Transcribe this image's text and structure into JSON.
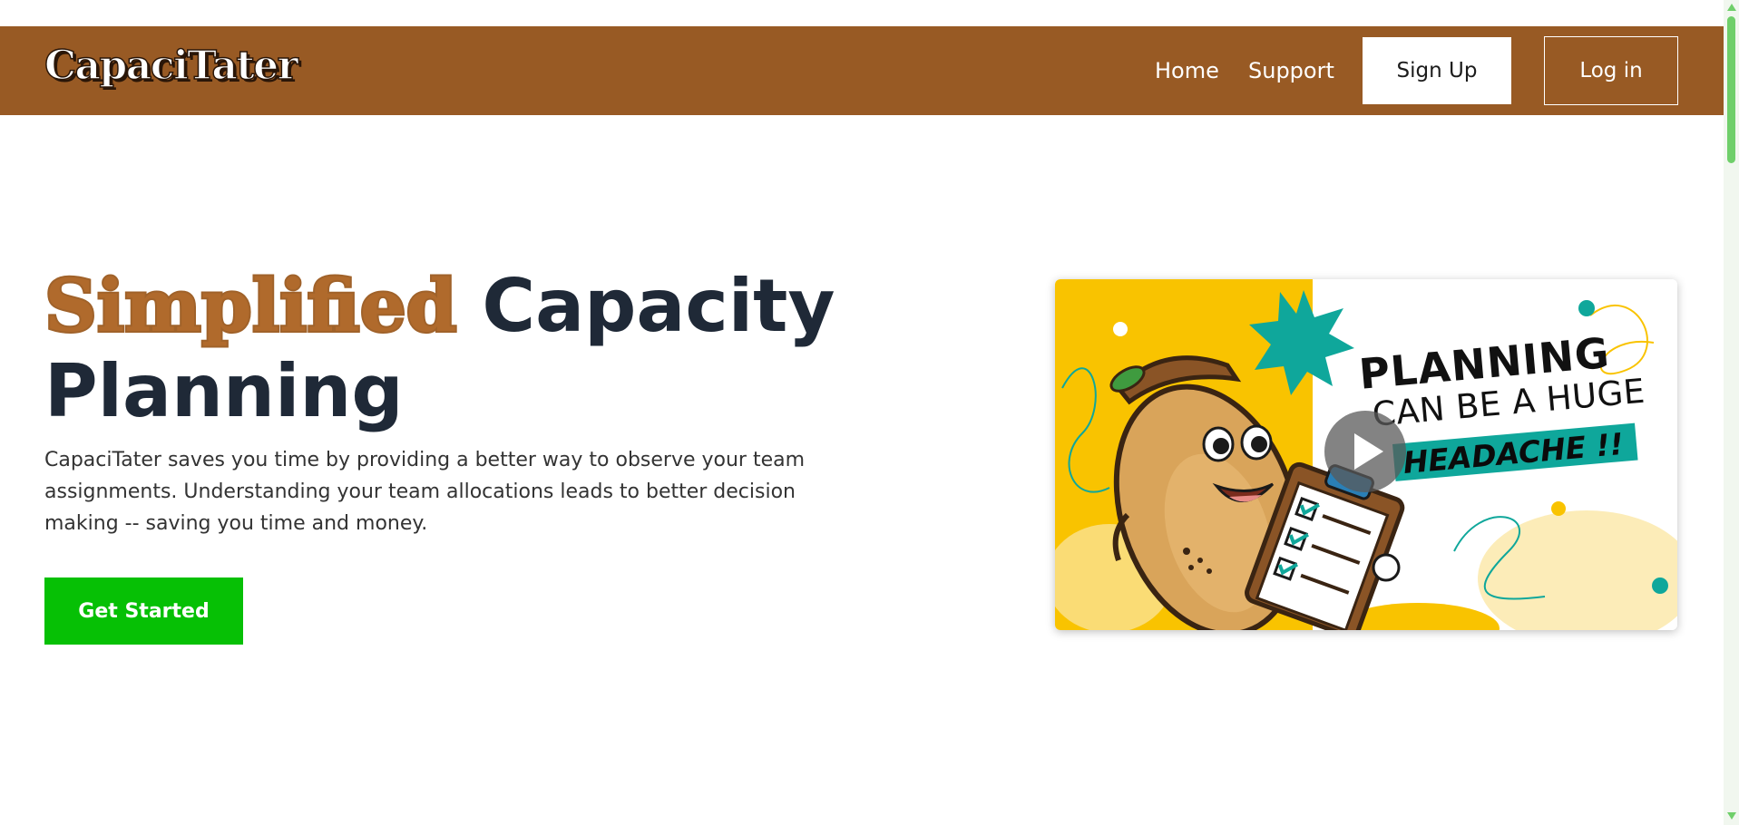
{
  "header": {
    "logo_text": "CapaciTater",
    "nav": {
      "home_label": "Home",
      "support_label": "Support",
      "signup_label": "Sign Up",
      "login_label": "Log in"
    }
  },
  "hero": {
    "heading_accent": "Simplified",
    "heading_rest_line1": " Capacity",
    "heading_line2": "Planning",
    "paragraph": "CapaciTater saves you time by providing a better way to observe your team assignments. Understanding your team allocations leads to better decision making -- saving you time and money.",
    "cta_label": "Get Started"
  },
  "video": {
    "thumbnail_line1": "PLANNING",
    "thumbnail_line2": "CAN BE A HUGE",
    "thumbnail_line3": "HEADACHE !!",
    "play_icon": "play-icon"
  },
  "colors": {
    "nav_background": "#985a24",
    "accent_brown": "#a0622a",
    "cta_green": "#06c005",
    "heading_dark": "#1f2937",
    "thumbnail_yellow": "#f9c300",
    "thumbnail_teal": "#0fa79b",
    "scrollbar_green": "#6fcf6a"
  }
}
